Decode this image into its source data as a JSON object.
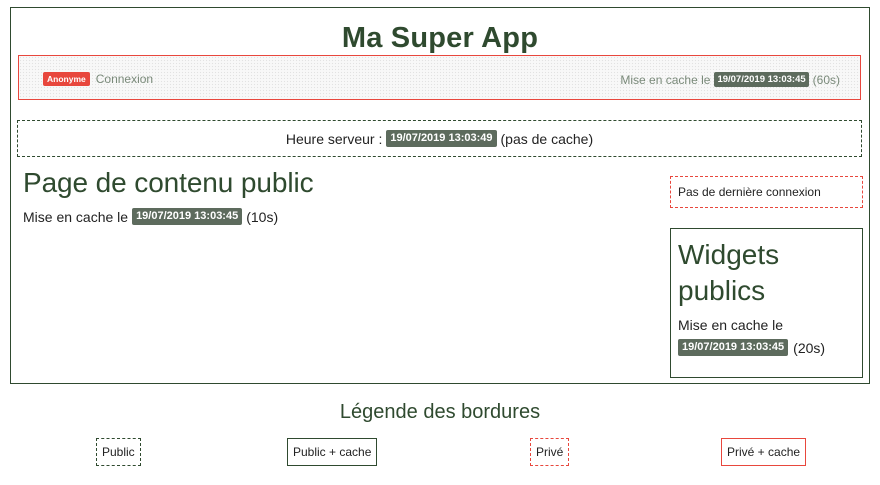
{
  "app": {
    "title": "Ma Super App"
  },
  "header": {
    "user_badge": "Anonyme",
    "login_link": "Connexion",
    "cache_prefix": "Mise en cache le",
    "cache_timestamp": "19/07/2019 13:03:45",
    "cache_duration": "(60s)"
  },
  "server": {
    "label": "Heure serveur :",
    "timestamp": "19/07/2019 13:03:49",
    "note": "(pas de cache)"
  },
  "main": {
    "heading": "Page de contenu public",
    "cache_prefix": "Mise en cache le",
    "cache_timestamp": "19/07/2019 13:03:45",
    "cache_duration": "(10s)"
  },
  "last_login": {
    "text": "Pas de dernière connexion"
  },
  "widgets": {
    "title": "Widgets publics",
    "cache_prefix": "Mise en cache le",
    "cache_timestamp": "19/07/2019 13:03:45",
    "cache_duration": "(20s)"
  },
  "legend": {
    "title": "Légende des bordures",
    "items": [
      {
        "label": "Public",
        "style": "dashed",
        "color": "#2f4a2f"
      },
      {
        "label": "Public + cache",
        "style": "solid",
        "color": "#2f4a2f"
      },
      {
        "label": "Privé",
        "style": "dashed",
        "color": "#e8473d"
      },
      {
        "label": "Privé + cache",
        "style": "solid",
        "color": "#e8473d"
      }
    ]
  },
  "colors": {
    "public": "#2f4a2f",
    "private": "#e8473d",
    "timestamp_badge": "#5d6b5d"
  }
}
